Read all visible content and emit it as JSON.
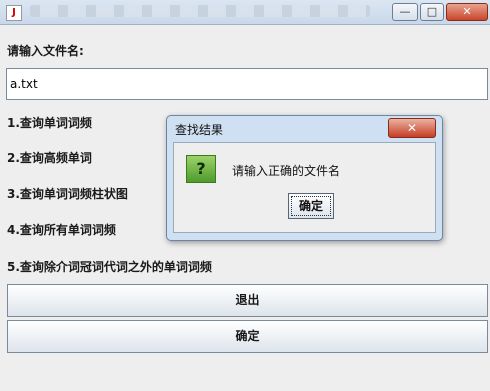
{
  "window": {
    "title_icon": "java-icon",
    "minimize_label": "—",
    "maximize_label": "□",
    "close_label": "✕"
  },
  "form": {
    "prompt_label": "请输入文件名:",
    "filename_value": "a.txt",
    "options": [
      "1.查询单词词频",
      "2.查询高频单词",
      "3.查询单词词频柱状图",
      "4.查询所有单词词频",
      "5.查询除介词冠词代词之外的单词词频"
    ],
    "exit_label": "退出",
    "confirm_label": "确定"
  },
  "dialog": {
    "title": "查找结果",
    "close_label": "✕",
    "icon": "question-icon",
    "icon_glyph": "?",
    "message": "请输入正确的文件名",
    "ok_label": "确定"
  }
}
